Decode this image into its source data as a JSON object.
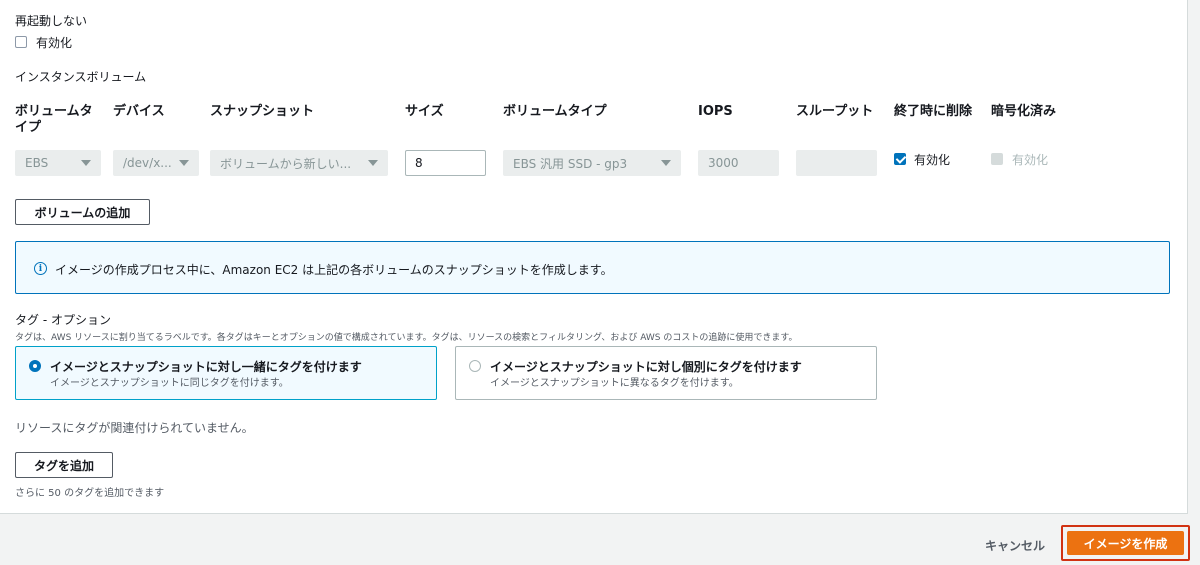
{
  "no_reboot": {
    "label": "再起動しない",
    "checkbox_label": "有効化",
    "checked": false
  },
  "instance_volumes": {
    "title": "インスタンスボリューム",
    "columns": [
      "ボリュームタ",
      "イプ",
      "デバイス",
      "スナップショット",
      "サイズ",
      "ボリュームタイプ",
      "IOPS",
      "スループット",
      "終了時に削除",
      "暗号化済み"
    ],
    "row": {
      "volume_type": "EBS",
      "device": "/dev/x...",
      "snapshot": "ボリュームから新しい...",
      "size": "8",
      "volume_kind": "EBS 汎用 SSD - gp3",
      "iops": "3000",
      "throughput": "",
      "delete_on_termination": {
        "label": "有効化",
        "checked": true
      },
      "encrypted": {
        "label": "有効化",
        "checked": false,
        "disabled": true
      }
    },
    "add_volume_button": "ボリュームの追加"
  },
  "info_alert": {
    "icon": "info-icon",
    "text": "イメージの作成プロセス中に、Amazon EC2 は上記の各ボリュームのスナップショットを作成します。"
  },
  "tags": {
    "title": "タグ - オプション",
    "description": "タグは、AWS リソースに割り当てるラベルです。各タグはキーとオプションの値で構成されています。タグは、リソースの検索とフィルタリング、および AWS のコストの追跡に使用できます。",
    "options": [
      {
        "title": "イメージとスナップショットに対し一緒にタグを付けます",
        "description": "イメージとスナップショットに同じタグを付けます。",
        "selected": true
      },
      {
        "title": "イメージとスナップショットに対し個別にタグを付けます",
        "description": "イメージとスナップショットに異なるタグを付けます。",
        "selected": false
      }
    ],
    "empty_text": "リソースにタグが関連付けられていません。",
    "add_tag_button": "タグを追加",
    "remaining_text": "さらに 50 のタグを追加できます"
  },
  "footer": {
    "cancel_label": "キャンセル",
    "create_label": "イメージを作成"
  },
  "colors": {
    "primary": "#ec7211",
    "info_border": "#0073bb",
    "highlight": "#d13212"
  }
}
